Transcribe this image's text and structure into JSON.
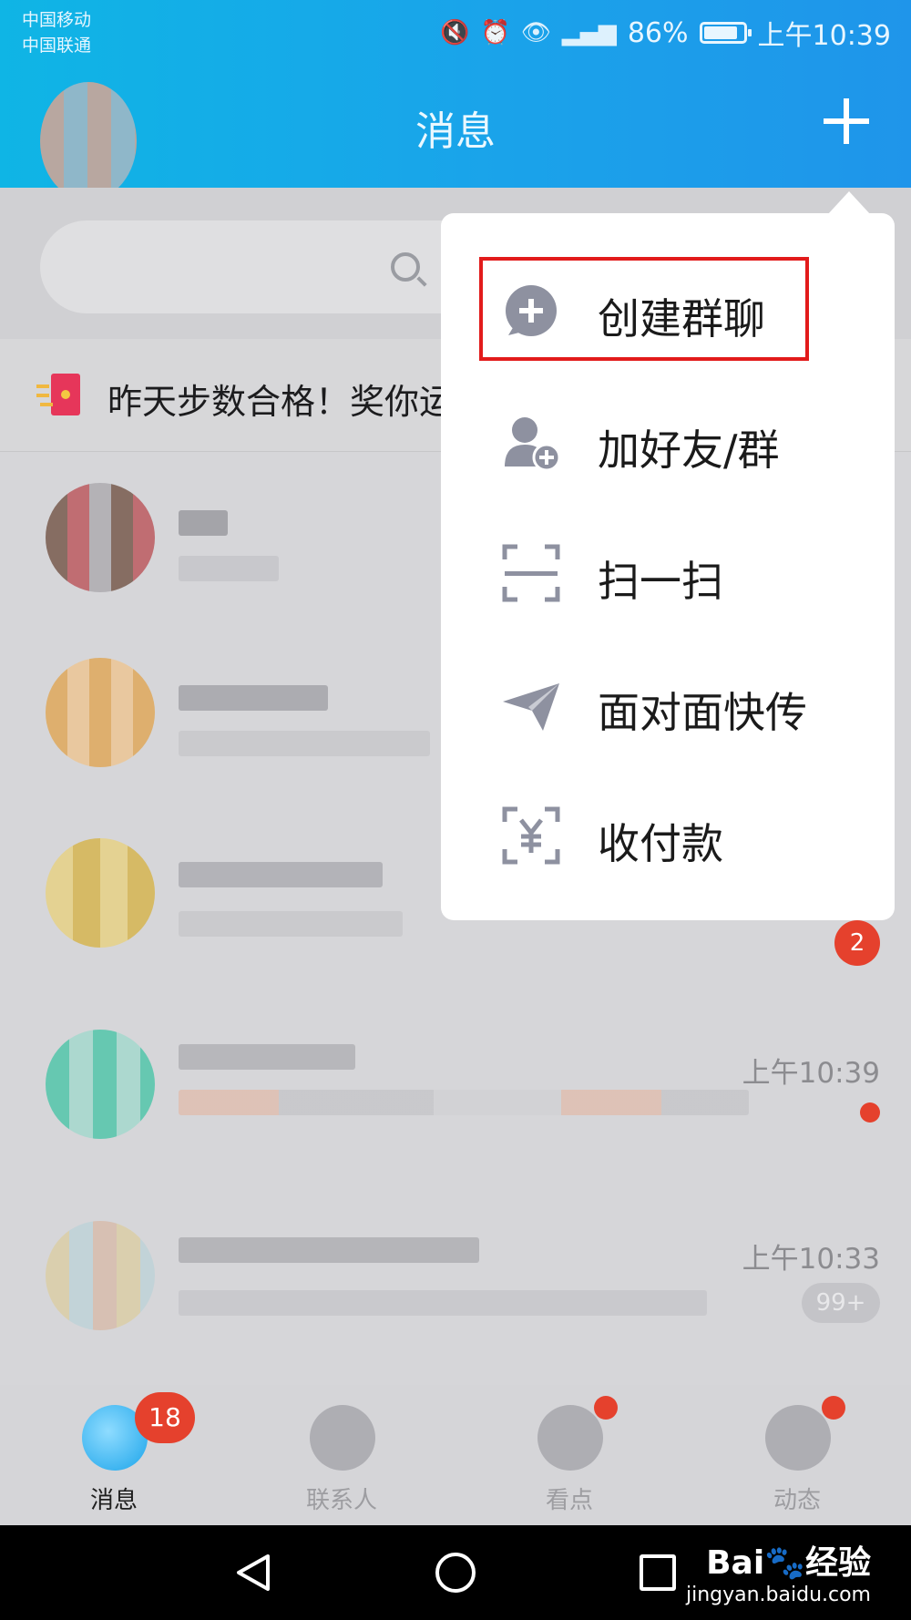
{
  "status_bar": {
    "carrier_1": "中国移动",
    "carrier_2": "中国联通",
    "battery": "86%",
    "time": "上午10:39"
  },
  "header": {
    "title": "消息"
  },
  "banner": {
    "text": "昨天步数合格！奖你运"
  },
  "chats": [
    {
      "time": "",
      "badge": ""
    },
    {
      "time": "",
      "badge": ""
    },
    {
      "time": "",
      "badge": "2"
    },
    {
      "time": "上午10:39",
      "badge": ""
    },
    {
      "time": "上午10:33",
      "badge": "99+"
    }
  ],
  "menu": {
    "items": [
      {
        "label": "创建群聊",
        "icon": "group-chat-add-icon"
      },
      {
        "label": "加好友/群",
        "icon": "add-friend-icon"
      },
      {
        "label": "扫一扫",
        "icon": "scan-icon"
      },
      {
        "label": "面对面快传",
        "icon": "send-plane-icon"
      },
      {
        "label": "收付款",
        "icon": "payment-scan-icon"
      }
    ]
  },
  "tabs": [
    {
      "label": "消息",
      "badge": "18"
    },
    {
      "label": "联系人"
    },
    {
      "label": "看点"
    },
    {
      "label": "动态"
    }
  ],
  "watermark": {
    "line1": "Bai🐾经验",
    "line2": "jingyan.baidu.com"
  },
  "colors": {
    "accent": "#1aa3ea",
    "badge": "#e5412d",
    "highlight": "#e21b1b"
  }
}
